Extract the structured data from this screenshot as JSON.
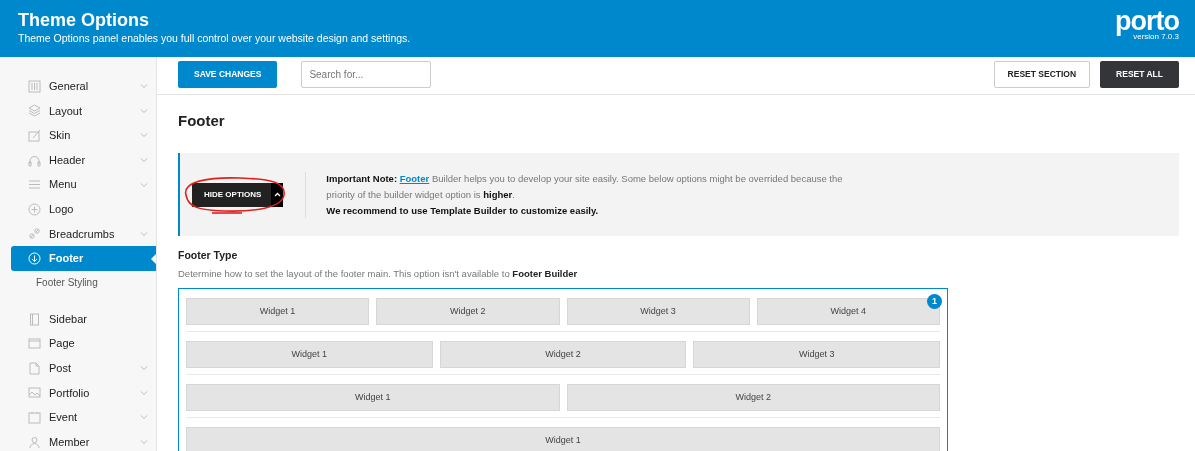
{
  "header": {
    "title": "Theme Options",
    "subtitle": "Theme Options panel enables you full control over your website design and settings.",
    "logo": "porto",
    "version": "version 7.0.3"
  },
  "sidebar": {
    "items": [
      {
        "label": "General",
        "expandable": true,
        "selected": false
      },
      {
        "label": "Layout",
        "expandable": true,
        "selected": false
      },
      {
        "label": "Skin",
        "expandable": true,
        "selected": false
      },
      {
        "label": "Header",
        "expandable": true,
        "selected": false
      },
      {
        "label": "Menu",
        "expandable": true,
        "selected": false
      },
      {
        "label": "Logo",
        "expandable": false,
        "selected": false
      },
      {
        "label": "Breadcrumbs",
        "expandable": true,
        "selected": false
      },
      {
        "label": "Footer",
        "expandable": false,
        "selected": true,
        "children": [
          {
            "label": "Footer Styling"
          }
        ]
      },
      {
        "label": "Sidebar",
        "expandable": false,
        "selected": false
      },
      {
        "label": "Page",
        "expandable": false,
        "selected": false
      },
      {
        "label": "Post",
        "expandable": true,
        "selected": false
      },
      {
        "label": "Portfolio",
        "expandable": true,
        "selected": false
      },
      {
        "label": "Event",
        "expandable": true,
        "selected": false
      },
      {
        "label": "Member",
        "expandable": true,
        "selected": false
      }
    ]
  },
  "toolbar": {
    "save": "SAVE CHANGES",
    "search": {
      "placeholder": "Search for..."
    },
    "reset_section": "RESET SECTION",
    "reset_all": "RESET ALL"
  },
  "section_title": "Footer",
  "note": {
    "button": "HIDE OPTIONS",
    "lead": "Important Note:",
    "link": "Footer",
    "text": " Builder helps you to develop your site easily. Some below options might be overrided because the priority of the builder widget option is **higher**.",
    "line2": "We recommend to use Template Builder to customize easily."
  },
  "footer_type": {
    "label": "Footer Type",
    "description": "Determine how to set the layout of the footer main. This option isn't available to **Footer Builder**",
    "layouts": [
      {
        "selected": true,
        "badge": "1",
        "widgets": [
          "Widget 1",
          "Widget 2",
          "Widget 3",
          "Widget 4"
        ]
      },
      {
        "selected": false,
        "widgets": [
          "Widget 1",
          "Widget 2",
          "Widget 3"
        ]
      },
      {
        "selected": false,
        "widgets": [
          "Widget 1",
          "Widget 2"
        ]
      },
      {
        "selected": false,
        "widgets": [
          "Widget 1"
        ]
      }
    ]
  }
}
